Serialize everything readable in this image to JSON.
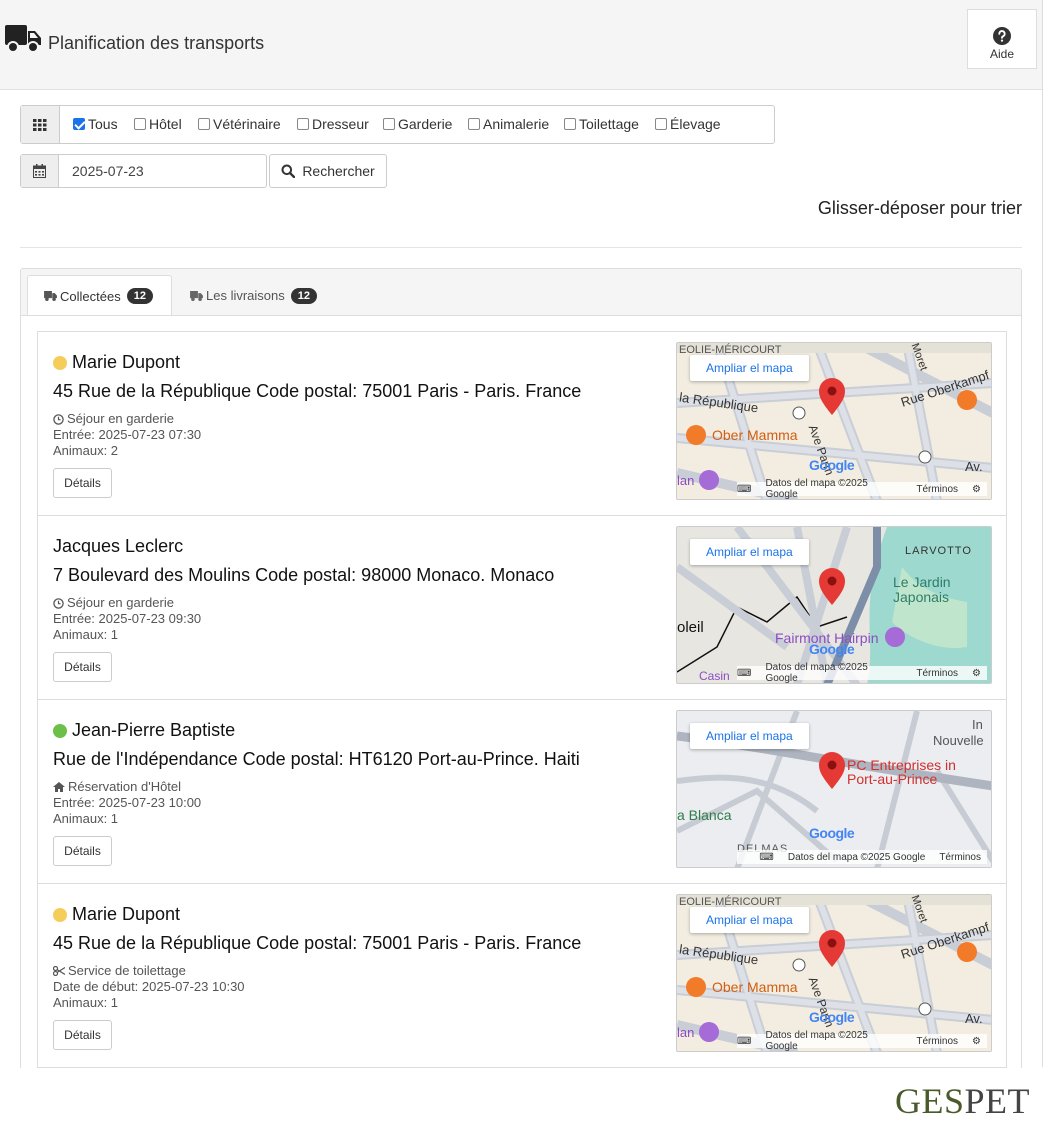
{
  "header": {
    "title": "Planification des transports",
    "help_label": "Aide"
  },
  "filters": [
    {
      "label": "Tous",
      "checked": true
    },
    {
      "label": "Hôtel",
      "checked": false
    },
    {
      "label": "Vétérinaire",
      "checked": false
    },
    {
      "label": "Dresseur",
      "checked": false
    },
    {
      "label": "Garderie",
      "checked": false
    },
    {
      "label": "Animalerie",
      "checked": false
    },
    {
      "label": "Toilettage",
      "checked": false
    },
    {
      "label": "Élevage",
      "checked": false
    }
  ],
  "search": {
    "date_value": "2025-07-23",
    "button_label": "Rechercher"
  },
  "drag_hint": "Glisser-déposer pour trier",
  "tabs": [
    {
      "label": "Collectées",
      "count": "12"
    },
    {
      "label": "Les livraisons",
      "count": "12"
    }
  ],
  "cards": [
    {
      "name": "Marie Dupont",
      "status_color": "#f5cd5b",
      "address": "45 Rue de la République Code postal: 75001 Paris - Paris. France",
      "service": "Séjour en garderie",
      "service_icon": "clock-icon",
      "date_line": "Entrée: 2025-07-23 07:30",
      "animals": "Animaux: 2",
      "details_label": "Détails",
      "map": {
        "expand_label": "Ampliar el mapa",
        "footer_data": "Datos del mapa ©2025 Google",
        "footer_terms": "Términos",
        "google": "Google",
        "labels": [
          "Ober Mamma",
          "la République",
          "Rue Oberkampf",
          "Ave Parm",
          "Av.",
          "lan",
          "EOLIE-MÉRICOURT",
          "Moret"
        ]
      }
    },
    {
      "name": "Jacques Leclerc",
      "status_color": "",
      "address": "7 Boulevard des Moulins Code postal: 98000 Monaco. Monaco",
      "service": "Séjour en garderie",
      "service_icon": "clock-icon",
      "date_line": "Entrée: 2025-07-23 09:30",
      "animals": "Animaux: 1",
      "details_label": "Détails",
      "map": {
        "expand_label": "Ampliar el mapa",
        "footer_data": "Datos del mapa ©2025 Google",
        "footer_terms": "Términos",
        "google": "Google",
        "labels": [
          "LARVOTTO",
          "Le Jardin",
          "Japonais",
          "Fairmont Hairpin",
          "oleil",
          "Casin"
        ]
      }
    },
    {
      "name": "Jean-Pierre Baptiste",
      "status_color": "#6cc04a",
      "address": "Rue de l'Indépendance Code postal: HT6120 Port-au-Prince. Haiti",
      "service": "Réservation d'Hôtel",
      "service_icon": "home-icon",
      "date_line": "Entrée: 2025-07-23 10:00",
      "animals": "Animaux: 1",
      "details_label": "Détails",
      "map": {
        "expand_label": "Ampliar el mapa",
        "footer_data": "Datos del mapa ©2025 Google",
        "footer_terms": "Términos",
        "google": "Google",
        "labels": [
          "PC Entreprises in",
          "Port-au-Prince",
          "a Blanca",
          "DELMAS",
          "In",
          "Nouvelle"
        ]
      }
    },
    {
      "name": "Marie Dupont",
      "status_color": "#f5cd5b",
      "address": "45 Rue de la République Code postal: 75001 Paris - Paris. France",
      "service": "Service de toilettage",
      "service_icon": "scissors-icon",
      "date_line": "Date de début: 2025-07-23 10:30",
      "animals": "Animaux: 1",
      "details_label": "Détails",
      "map": {
        "expand_label": "Ampliar el mapa",
        "footer_data": "Datos del mapa ©2025 Google",
        "footer_terms": "Términos",
        "google": "Google",
        "labels": [
          "Ober Mamma",
          "la République",
          "Rue Oberkampf",
          "Ave Parm",
          "Av.",
          "lan",
          "EOLIE-MÉRICOURT",
          "Moret"
        ]
      }
    }
  ],
  "brand": {
    "part1": "GES",
    "part2": "PET"
  },
  "colors": {
    "accent_blue": "#1a73e8",
    "badge_dark": "#333333",
    "map_pin": "#e53935"
  }
}
